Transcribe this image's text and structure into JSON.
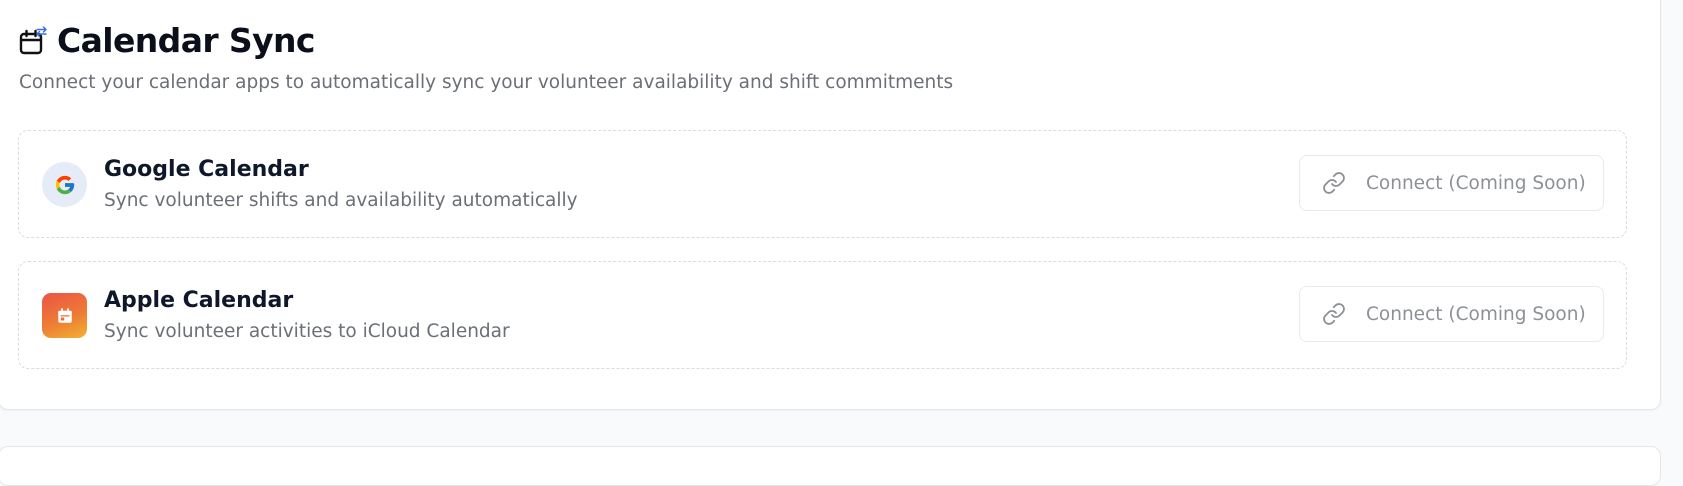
{
  "section": {
    "title": "Calendar Sync",
    "subtitle": "Connect your calendar apps to automatically sync your volunteer availability and shift commitments",
    "title_icon": "calendar-sync-icon"
  },
  "providers": [
    {
      "name": "Google Calendar",
      "description": "Sync volunteer shifts and availability automatically",
      "icon": "google-logo-icon",
      "button_label": "Connect (Coming Soon)",
      "button_icon": "link-icon",
      "button_disabled": true
    },
    {
      "name": "Apple Calendar",
      "description": "Sync volunteer activities to iCloud Calendar",
      "icon": "apple-calendar-icon",
      "button_label": "Connect (Coming Soon)",
      "button_icon": "link-icon",
      "button_disabled": true
    }
  ],
  "colors": {
    "title": "#0b0f19",
    "muted_text": "#6b6f76",
    "google_logo_bg": "#e6ecf7",
    "apple_gradient_start": "#ea5545",
    "apple_gradient_end": "#f2b233",
    "sync_arrow": "#3b6fe0"
  }
}
